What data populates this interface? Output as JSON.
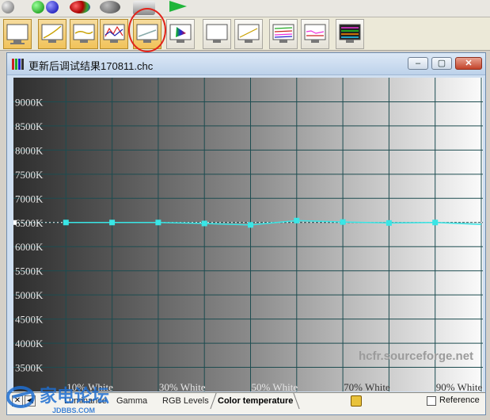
{
  "window": {
    "title": "更新后调试结果170811.chc",
    "min_label": "–",
    "max_label": "▢",
    "close_label": "✕"
  },
  "toolbar": {
    "buttons": [
      "luminance-view",
      "gamma-view",
      "rgb-levels-view",
      "color-temperature-view",
      "cie-diagram-view",
      "contrast-view",
      "near-black-view",
      "saturation-view",
      "saturation-shift-view",
      "color-comparison-view"
    ]
  },
  "chart_data": {
    "type": "line",
    "title": "",
    "xlabel": "",
    "ylabel": "",
    "x": [
      10,
      20,
      30,
      40,
      50,
      60,
      70,
      80,
      90,
      100
    ],
    "xlim": [
      0,
      100
    ],
    "ylim": [
      3000,
      9500
    ],
    "y_ticks": [
      "3500K",
      "4000K",
      "4500K",
      "5000K",
      "5500K",
      "6000K",
      "6500K",
      "7000K",
      "7500K",
      "8000K",
      "8500K",
      "9000K"
    ],
    "y_tick_values": [
      3500,
      4000,
      4500,
      5000,
      5500,
      6000,
      6500,
      7000,
      7500,
      8000,
      8500,
      9000
    ],
    "x_tick_labels": [
      "10% White",
      "30% White",
      "50% White",
      "70% White",
      "90% White"
    ],
    "x_tick_values": [
      10,
      30,
      50,
      70,
      90
    ],
    "reference_value": 6500,
    "series": [
      {
        "values": [
          6500,
          6500,
          6500,
          6480,
          6450,
          6540,
          6510,
          6490,
          6500,
          6460
        ],
        "color": "#39e6e6"
      }
    ],
    "annotation": "hcfr.sourceforge.net",
    "grid": true
  },
  "tabs": {
    "nav_close": "✕",
    "nav_prev": "◀",
    "items": [
      "Luminance",
      "Gamma",
      "RGB Levels",
      "Color temperature"
    ],
    "active": "Color temperature",
    "reference_label": "Reference"
  },
  "watermark": {
    "text": "家电论坛",
    "subtext": "JDBBS.COM"
  },
  "colors": {
    "accent": "#39e6e6",
    "grid": "#1d4c50",
    "circle": "#e2231a"
  }
}
